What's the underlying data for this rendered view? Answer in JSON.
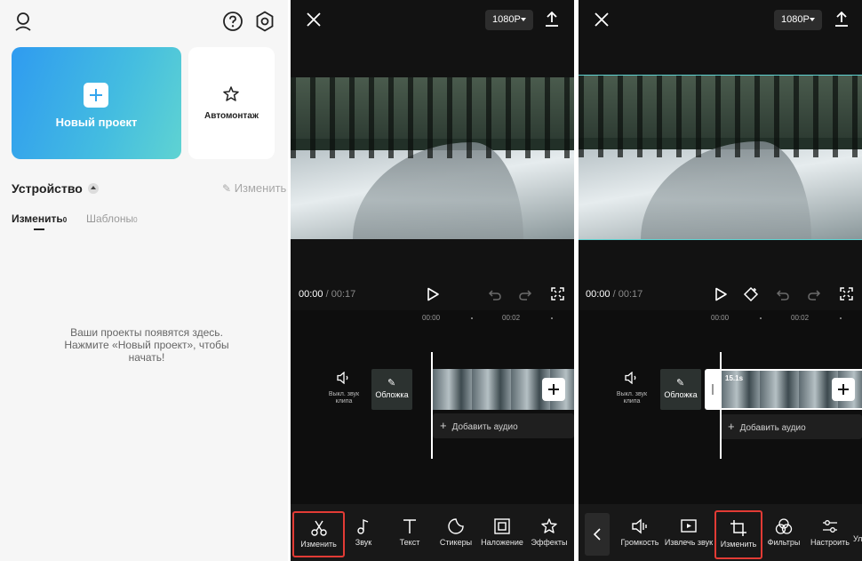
{
  "panel1": {
    "new_project_label": "Новый проект",
    "automontage_label": "Автомонтаж",
    "section_title": "Устройство",
    "edit_link": "Изменить",
    "tabs": [
      {
        "label": "Изменить",
        "count": "0"
      },
      {
        "label": "Шаблоны",
        "count": "0"
      }
    ],
    "empty_message": [
      "Ваши проекты появятся здесь.",
      "Нажмите «Новый проект», чтобы",
      "начать!"
    ]
  },
  "panel2": {
    "resolution": "1080P",
    "time_current": "00:00",
    "time_sep": " / ",
    "time_total": "00:17",
    "ruler_labels": [
      "00:00",
      "00:02"
    ],
    "mute_label": [
      "Выкл. звук",
      "клипа"
    ],
    "cover_label": "Обложка",
    "add_audio_label": "Добавить аудио",
    "tools": [
      "Изменить",
      "Звук",
      "Текст",
      "Стикеры",
      "Наложение",
      "Эффекты"
    ]
  },
  "panel3": {
    "resolution": "1080P",
    "time_current": "00:00",
    "time_sep": " / ",
    "time_total": "00:17",
    "ruler_labels": [
      "00:00",
      "00:02"
    ],
    "mute_label": [
      "Выкл. звук",
      "клипа"
    ],
    "cover_label": "Обложка",
    "clip_duration": "15.1s",
    "add_audio_label": "Добавить аудио",
    "tools": [
      "Громкость",
      "Извлечь звук",
      "Изменить",
      "Фильтры",
      "Настроить",
      "Ул"
    ]
  },
  "colors": {
    "accent_highlight": "#e23b35",
    "gradient_start": "#2f9bf0",
    "gradient_end": "#5fd3d2",
    "dark_bg": "#121212"
  }
}
